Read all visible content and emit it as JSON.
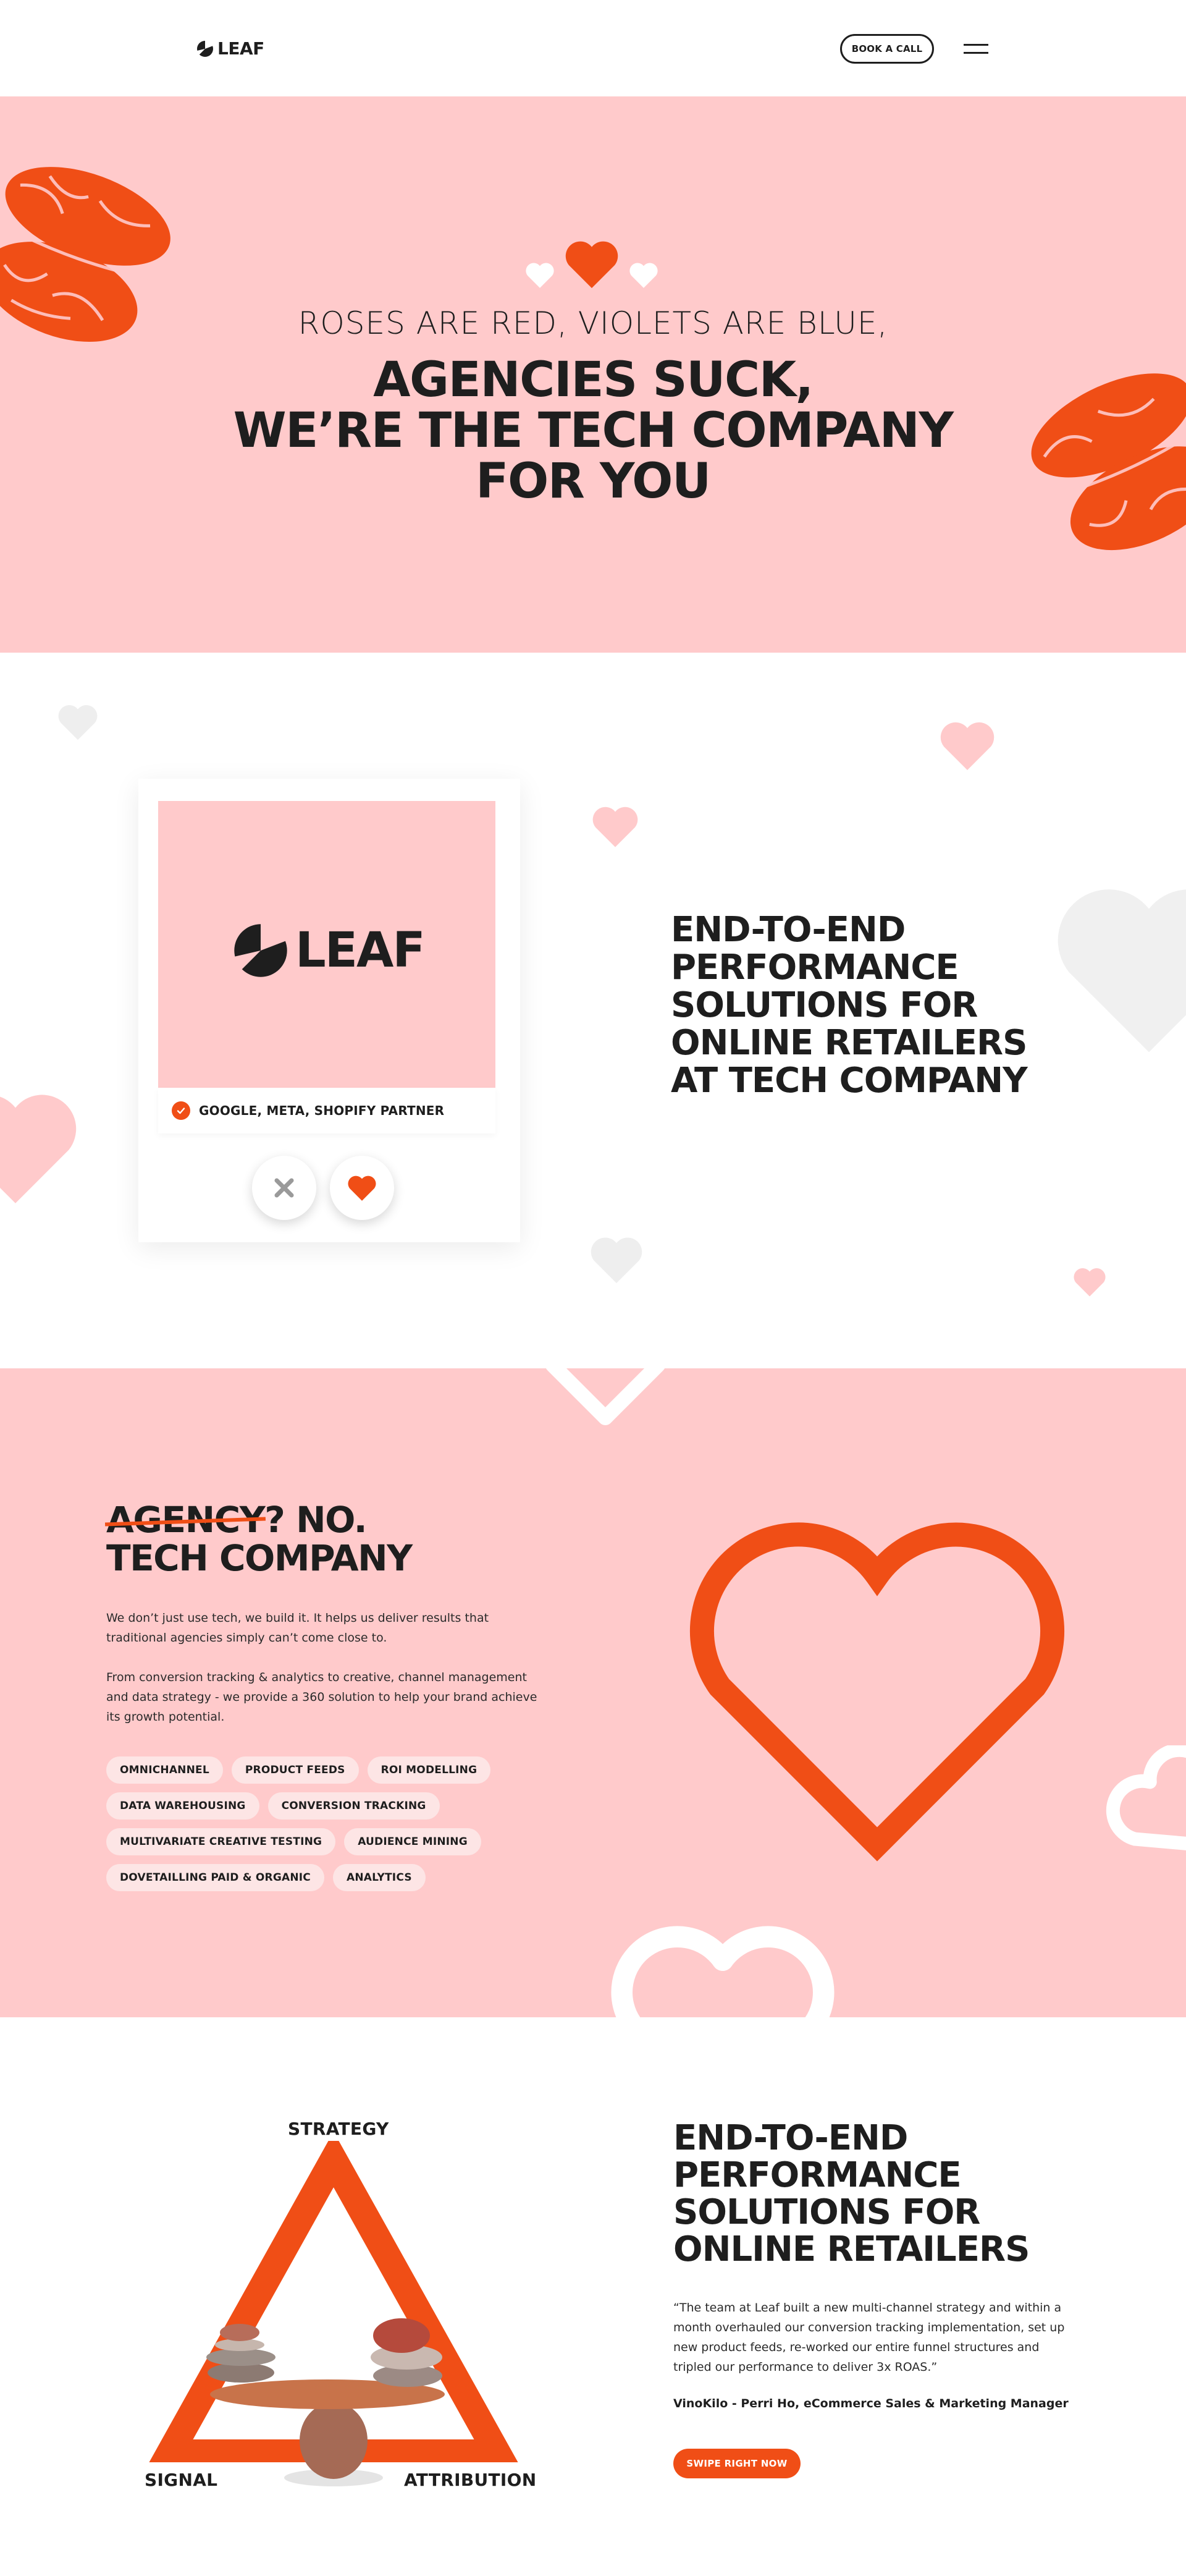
{
  "header": {
    "logo_text": "LEAF",
    "book_call_label": "BOOK A CALL"
  },
  "hero": {
    "subtitle": "ROSES ARE RED, VIOLETS ARE BLUE,",
    "title_lines": [
      "AGENCIES SUCK,",
      "WE’RE THE TECH COMPANY",
      "FOR YOU"
    ]
  },
  "intro": {
    "card_logo_text": "LEAF",
    "badge_text": "GOOGLE, META, SHOPIFY PARTNER",
    "title_lines": [
      "END-TO-END",
      "PERFORMANCE",
      "SOLUTIONS FOR",
      "ONLINE RETAILERS",
      "AT TECH COMPANY"
    ]
  },
  "tech": {
    "title_strike": "AGENCY",
    "title_rest": "? NO.",
    "title_line2": "TECH COMPANY",
    "paragraph1": "We don’t just use tech, we build it. It helps us deliver results that traditional agencies simply can’t come close to.",
    "paragraph2": "From conversion tracking & analytics to creative, channel management and data strategy - we provide a 360 solution to help your brand achieve its growth potential.",
    "tags": [
      "OMNICHANNEL",
      "PRODUCT FEEDS",
      "ROI MODELLING",
      "DATA WAREHOUSING",
      "CONVERSION TRACKING",
      "MULTIVARIATE CREATIVE TESTING",
      "AUDIENCE MINING",
      "DOVETAILLING PAID & ORGANIC",
      "ANALYTICS"
    ]
  },
  "results": {
    "triangle_labels": {
      "top": "STRATEGY",
      "left": "SIGNAL",
      "right": "ATTRIBUTION"
    },
    "title_lines": [
      "END-TO-END",
      "PERFORMANCE",
      "SOLUTIONS FOR",
      "ONLINE RETAILERS"
    ],
    "quote": "“The team at Leaf built a new multi-channel strategy and within a month overhauled our conversion tracking implementation, set up new product feeds, re-worked our entire funnel structures and tripled our performance to deliver 3x ROAS.”",
    "author": "VinoKilo - Perri Ho, eCommerce Sales & Marketing Manager",
    "cta_label": "SWIPE RIGHT NOW"
  },
  "colors": {
    "accent": "#f04e16",
    "pink": "#ffcacb",
    "dark": "#1e1e1e",
    "tag_bg": "#fde5e5"
  },
  "icons": [
    "leaf-logo-icon",
    "menu-icon",
    "heart-icon",
    "lips-icon",
    "check-icon",
    "close-icon",
    "stacked-stones-icon"
  ]
}
